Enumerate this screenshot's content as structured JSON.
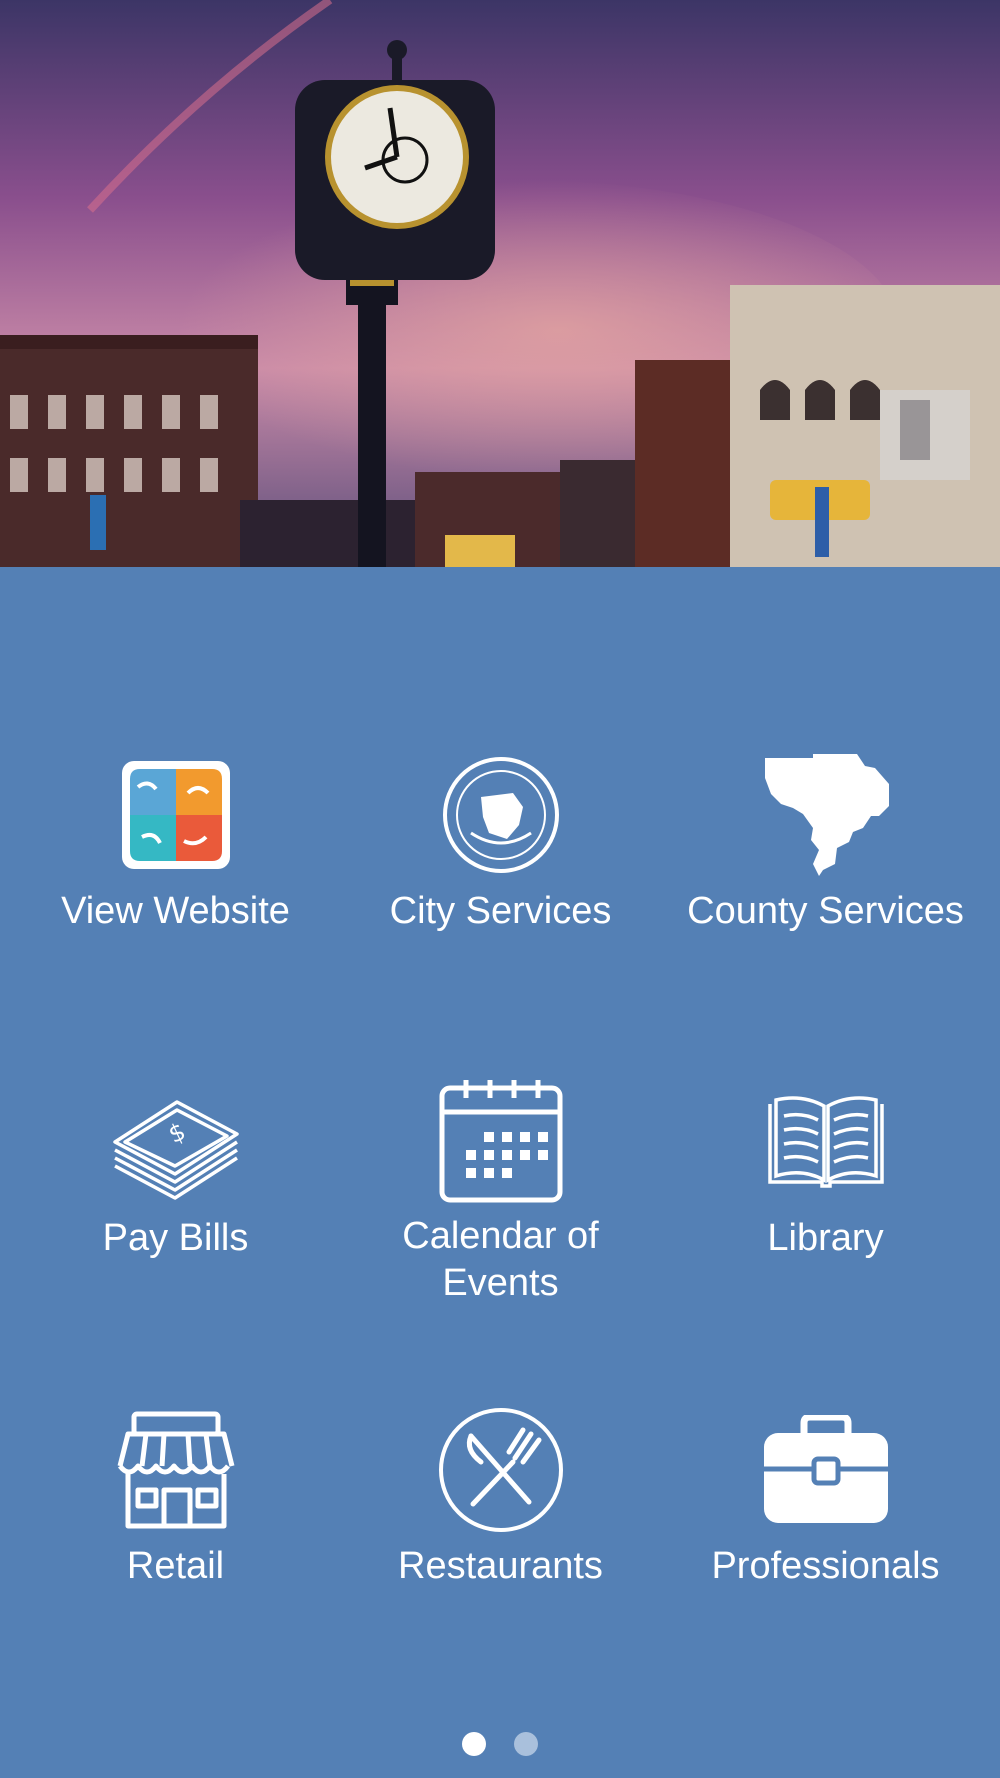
{
  "hero": {
    "alt_scene": "clock-tower-sunset-photo"
  },
  "tiles": [
    {
      "label": "View Website",
      "icon": "website-logo-icon"
    },
    {
      "label": "City Services",
      "icon": "city-seal-icon"
    },
    {
      "label": "County Services",
      "icon": "county-map-icon"
    },
    {
      "label": "Pay Bills",
      "icon": "money-stack-icon"
    },
    {
      "label": "Calendar of\nEvents",
      "icon": "calendar-icon"
    },
    {
      "label": "Library",
      "icon": "open-book-icon"
    },
    {
      "label": "Retail",
      "icon": "storefront-icon"
    },
    {
      "label": "Restaurants",
      "icon": "fork-knife-icon"
    },
    {
      "label": "Professionals",
      "icon": "briefcase-icon"
    }
  ],
  "pager": {
    "pages": 2,
    "current": 1
  },
  "colors": {
    "background": "#5480b5",
    "icon": "#ffffff",
    "dot_inactive": "#a9c0dc"
  }
}
